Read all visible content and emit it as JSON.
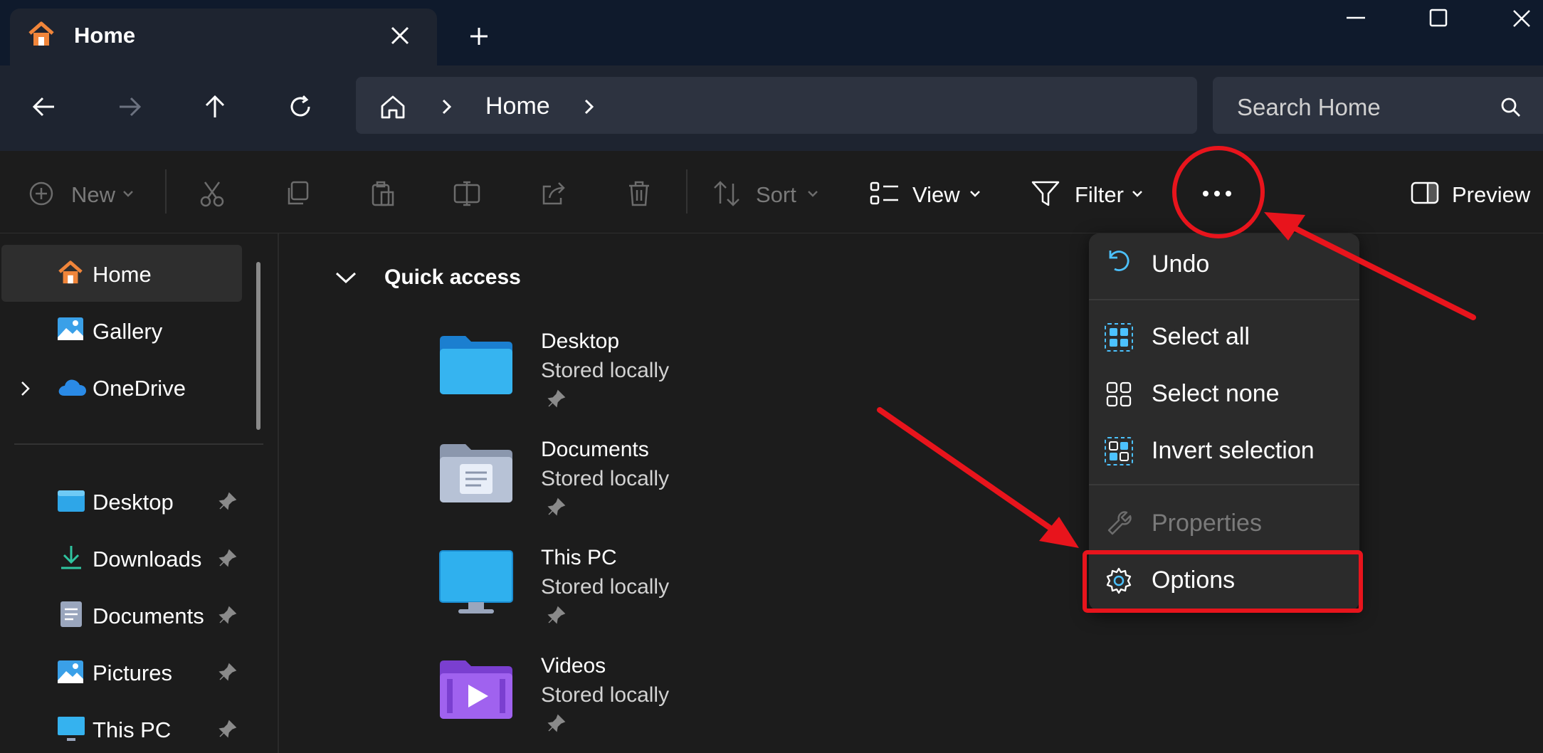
{
  "window": {
    "tab_title": "Home",
    "new_tab_symbol": "+"
  },
  "address": {
    "crumb": "Home",
    "search_placeholder": "Search Home"
  },
  "commands": {
    "new": "New",
    "sort": "Sort",
    "view": "View",
    "filter": "Filter",
    "preview": "Preview"
  },
  "sidebar": {
    "top": [
      {
        "label": "Home",
        "icon": "home-icon"
      },
      {
        "label": "Gallery",
        "icon": "gallery-icon"
      },
      {
        "label": "OneDrive",
        "icon": "onedrive-icon"
      }
    ],
    "pinned": [
      {
        "label": "Desktop",
        "icon": "desktop-folder-icon"
      },
      {
        "label": "Downloads",
        "icon": "downloads-icon"
      },
      {
        "label": "Documents",
        "icon": "documents-icon"
      },
      {
        "label": "Pictures",
        "icon": "pictures-icon"
      },
      {
        "label": "This PC",
        "icon": "this-pc-icon"
      }
    ]
  },
  "quick_access": {
    "title": "Quick access",
    "items": [
      {
        "name": "Desktop",
        "status": "Stored locally",
        "icon": "desktop-folder-icon"
      },
      {
        "name": "Documents",
        "status": "Stored locally",
        "icon": "documents-folder-icon"
      },
      {
        "name": "This PC",
        "status": "Stored locally",
        "icon": "monitor-icon"
      },
      {
        "name": "Videos",
        "status": "Stored locally",
        "icon": "videos-folder-icon"
      }
    ]
  },
  "menu": {
    "undo": "Undo",
    "select_all": "Select all",
    "select_none": "Select none",
    "invert_selection": "Invert selection",
    "properties": "Properties",
    "options": "Options"
  },
  "colors": {
    "accent": "#4cc2ff",
    "annotation_red": "#e8141c",
    "home_icon_orange": "#f0853a"
  }
}
